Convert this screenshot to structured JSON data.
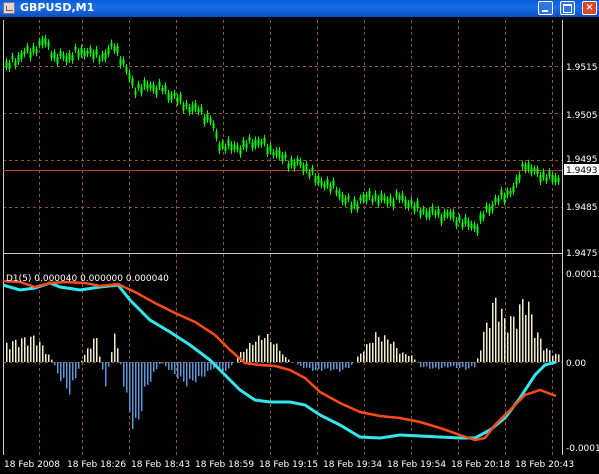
{
  "window": {
    "title": "GBPUSD,M1",
    "min_glyph": "",
    "max_glyph": "",
    "close_glyph": "×"
  },
  "colors": {
    "background": "#000000",
    "grid": "#8a5a2a",
    "candle": "#00ff00",
    "price_line": "#b04020",
    "fast_line": "#33e6ee",
    "slow_line": "#ff4a1a",
    "hist_up": "#f2f0c8",
    "hist_down": "#5f94d2",
    "axis_text": "#ffffff"
  },
  "price_panel": {
    "ticks": [
      "1.9515",
      "1.9505",
      "1.9495",
      "1.9485",
      "1.9475"
    ],
    "current_price": "1.9493"
  },
  "indicator_panel": {
    "label": "D1(5) 0.000040 0.000000 0.000040",
    "ticks": [
      "0.00013",
      "0.00",
      "-0.00013"
    ]
  },
  "time_axis": {
    "labels": [
      "18 Feb 2008",
      "18 Feb 18:26",
      "18 Feb 18:43",
      "18 Feb 18:59",
      "18 Feb 19:15",
      "18 Feb 19:34",
      "18 Feb 19:54",
      "18 Feb 20:18",
      "18 Feb 20:43"
    ]
  }
}
